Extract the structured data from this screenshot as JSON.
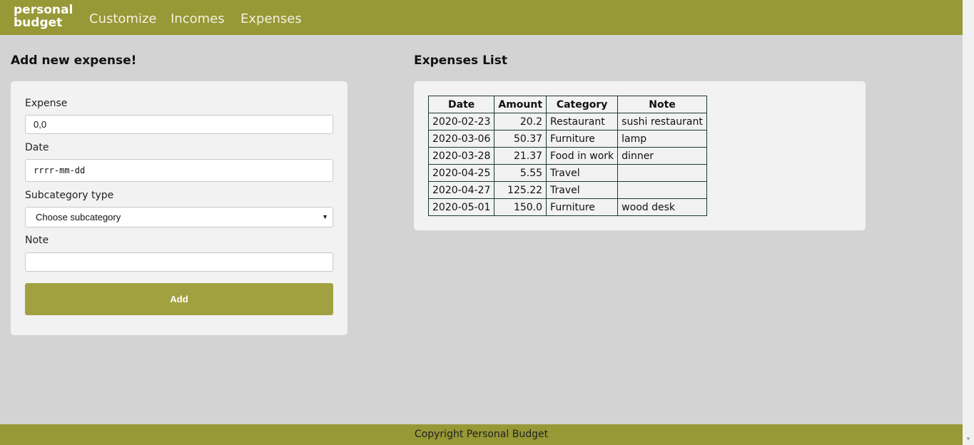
{
  "brand": {
    "line1": "personal",
    "line2": "budget"
  },
  "nav": [
    {
      "label": "Customize"
    },
    {
      "label": "Incomes"
    },
    {
      "label": "Expenses"
    }
  ],
  "form": {
    "heading": "Add new expense!",
    "expense_label": "Expense",
    "expense_value": "0,0",
    "date_label": "Date",
    "date_value": "rrrr-mm-dd",
    "subcategory_label": "Subcategory type",
    "subcategory_selected": "Choose subcategory",
    "note_label": "Note",
    "note_value": "",
    "add_label": "Add"
  },
  "list": {
    "heading": "Expenses List",
    "columns": [
      "Date",
      "Amount",
      "Category",
      "Note"
    ],
    "rows": [
      [
        "2020-02-23",
        "20.2",
        "Restaurant",
        "sushi restaurant"
      ],
      [
        "2020-03-06",
        "50.37",
        "Furniture",
        "lamp"
      ],
      [
        "2020-03-28",
        "21.37",
        "Food in work",
        "dinner"
      ],
      [
        "2020-04-25",
        "5.55",
        "Travel",
        ""
      ],
      [
        "2020-04-27",
        "125.22",
        "Travel",
        ""
      ],
      [
        "2020-05-01",
        "150.0",
        "Furniture",
        "wood desk"
      ]
    ]
  },
  "footer": {
    "text": "Copyright Personal Budget"
  },
  "icons": {
    "select_caret": "chevron-down-icon",
    "scroll_down": "scroll-down-arrow-icon"
  },
  "colors": {
    "accent": "#979836",
    "button": "#a1a142",
    "background": "#d3d3d3",
    "card": "#f2f2f2"
  }
}
